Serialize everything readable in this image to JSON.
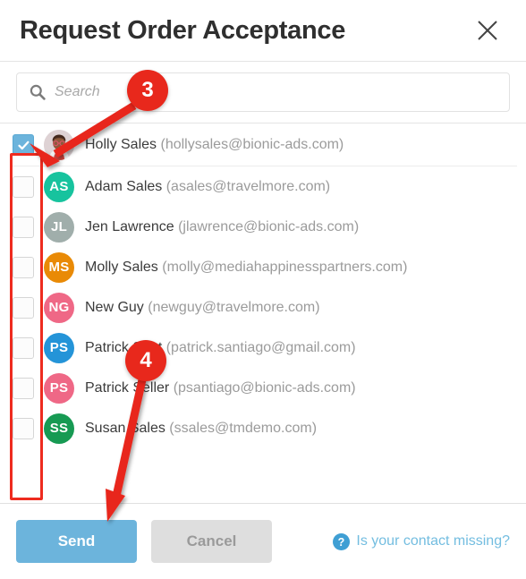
{
  "dialog": {
    "title": "Request Order Acceptance",
    "close_icon": "close-icon"
  },
  "search": {
    "placeholder": "Search",
    "value": "",
    "icon": "search-icon"
  },
  "contacts": [
    {
      "name": "Holly Sales",
      "email": "(hollysales@bionic-ads.com)",
      "initials": "",
      "avatar_type": "photo",
      "avatar_color": "#d9ccd0",
      "checked": true
    },
    {
      "name": "Adam Sales",
      "email": "(asales@travelmore.com)",
      "initials": "AS",
      "avatar_type": "initials",
      "avatar_color": "#17c39e",
      "checked": false
    },
    {
      "name": "Jen Lawrence",
      "email": "(jlawrence@bionic-ads.com)",
      "initials": "JL",
      "avatar_type": "initials",
      "avatar_color": "#a0aeab",
      "checked": false
    },
    {
      "name": "Molly Sales",
      "email": "(molly@mediahappinesspartners.com)",
      "initials": "MS",
      "avatar_type": "initials",
      "avatar_color": "#e98a06",
      "checked": false
    },
    {
      "name": "New Guy",
      "email": "(newguy@travelmore.com)",
      "initials": "NG",
      "avatar_type": "initials",
      "avatar_color": "#ef6886",
      "checked": false
    },
    {
      "name": "Patrick Sant",
      "email": "(patrick.santiago@gmail.com)",
      "initials": "PS",
      "avatar_type": "initials",
      "avatar_color": "#2494d8",
      "checked": false
    },
    {
      "name": "Patrick Seller",
      "email": "(psantiago@bionic-ads.com)",
      "initials": "PS",
      "avatar_type": "initials",
      "avatar_color": "#ef6886",
      "checked": false
    },
    {
      "name": "Susan Sales",
      "email": "(ssales@tmdemo.com)",
      "initials": "SS",
      "avatar_type": "initials",
      "avatar_color": "#179a53",
      "checked": false
    }
  ],
  "footer": {
    "send_label": "Send",
    "cancel_label": "Cancel",
    "help_label": "Is your contact missing?",
    "help_icon": "question-circle-icon"
  },
  "annotations": {
    "color": "#e8281c",
    "step_3": "3",
    "step_4": "4"
  },
  "colors": {
    "accent": "#6cb4dc",
    "annotation": "#e8281c",
    "link": "#73bde0"
  }
}
